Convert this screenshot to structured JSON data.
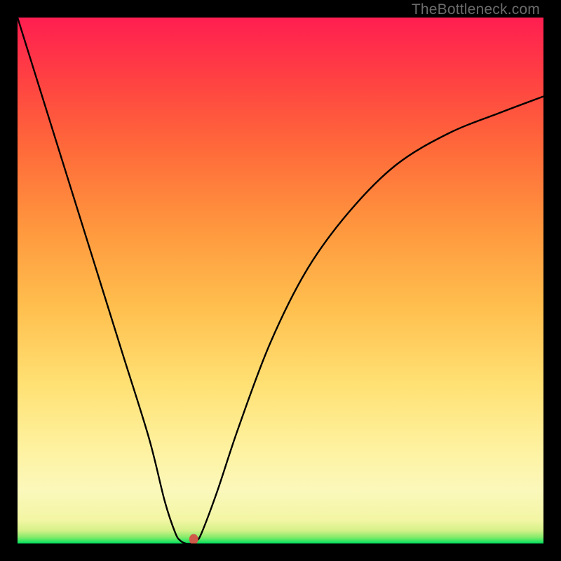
{
  "watermark": "TheBottleneck.com",
  "chart_data": {
    "type": "line",
    "title": "",
    "xlabel": "",
    "ylabel": "",
    "xlim": [
      0,
      100
    ],
    "ylim": [
      0,
      100
    ],
    "x": [
      0,
      5,
      10,
      15,
      20,
      25,
      28,
      30,
      31,
      32,
      33,
      34,
      35,
      38,
      42,
      48,
      55,
      63,
      72,
      82,
      92,
      100
    ],
    "values": [
      100,
      84,
      68,
      52,
      36,
      20,
      8,
      2,
      0.5,
      0,
      0,
      0.5,
      2,
      10,
      22,
      38,
      52,
      63,
      72,
      78,
      82,
      85
    ],
    "marker": {
      "x": 33.5,
      "y": 0.8
    },
    "gradient_stops": [
      {
        "offset": 0.0,
        "color": "#00e35e"
      },
      {
        "offset": 0.012,
        "color": "#86eb6a"
      },
      {
        "offset": 0.025,
        "color": "#d6f18a"
      },
      {
        "offset": 0.045,
        "color": "#f3f6a4"
      },
      {
        "offset": 0.1,
        "color": "#fbf8bb"
      },
      {
        "offset": 0.18,
        "color": "#fef2a0"
      },
      {
        "offset": 0.3,
        "color": "#ffe174"
      },
      {
        "offset": 0.45,
        "color": "#ffbf4e"
      },
      {
        "offset": 0.6,
        "color": "#ff973e"
      },
      {
        "offset": 0.75,
        "color": "#ff6a3a"
      },
      {
        "offset": 0.88,
        "color": "#ff4242"
      },
      {
        "offset": 1.0,
        "color": "#ff1e51"
      }
    ]
  }
}
